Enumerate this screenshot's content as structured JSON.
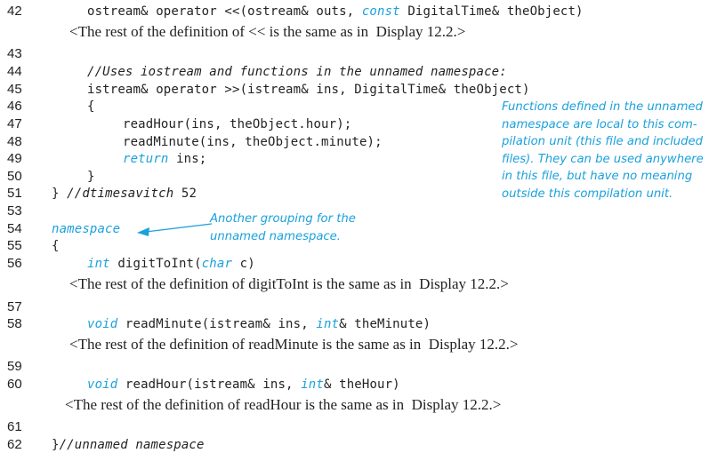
{
  "listing": {
    "lines": [
      {
        "num": "42",
        "parts": [
          {
            "t": "ostream& operator <<(ostream& outs, "
          },
          {
            "t": "const",
            "kw": true
          },
          {
            "t": " DigitalTime& theObject)"
          }
        ]
      },
      {
        "prose": "<The rest of the definition of << is the same as in  Display 12.2.>"
      },
      {
        "num": "43",
        "parts": []
      },
      {
        "num": "44",
        "parts": [
          {
            "t": "//Uses iostream and functions in the unnamed namespace:",
            "cm": true
          }
        ]
      },
      {
        "num": "45",
        "parts": [
          {
            "t": "istream& operator >>(istream& ins, DigitalTime& theObject)"
          }
        ]
      },
      {
        "num": "46",
        "parts": [
          {
            "t": "{"
          }
        ]
      },
      {
        "num": "47",
        "parts": [
          {
            "t": "readHour(ins, theObject.hour);"
          }
        ]
      },
      {
        "num": "48",
        "parts": [
          {
            "t": "readMinute(ins, theObject.minute);"
          }
        ]
      },
      {
        "num": "49",
        "parts": [
          {
            "t": "return",
            "kw": true
          },
          {
            "t": " ins;"
          }
        ]
      },
      {
        "num": "50",
        "parts": [
          {
            "t": "}"
          }
        ]
      },
      {
        "num": "51",
        "parts": [
          {
            "t": "} "
          },
          {
            "t": "//dtimesavitch",
            "cm": true
          },
          {
            "t": " 52"
          }
        ]
      },
      {
        "num": "53",
        "parts": []
      },
      {
        "num": "54",
        "parts": [
          {
            "t": "namespace",
            "kw": true
          }
        ]
      },
      {
        "num": "55",
        "parts": [
          {
            "t": "{"
          }
        ]
      },
      {
        "num": "56",
        "parts": [
          {
            "t": "int",
            "kw": true
          },
          {
            "t": " digitToInt("
          },
          {
            "t": "char",
            "kw": true
          },
          {
            "t": " c)"
          }
        ]
      },
      {
        "prose": "<The rest of the definition of digitToInt is the same as in  Display 12.2.>"
      },
      {
        "num": "57",
        "parts": []
      },
      {
        "num": "58",
        "parts": [
          {
            "t": "void",
            "kw": true
          },
          {
            "t": " readMinute(istream& ins, "
          },
          {
            "t": "int",
            "kw": true
          },
          {
            "t": "& theMinute)"
          }
        ]
      },
      {
        "prose": "<The rest of the definition of readMinute is the same as in  Display 12.2.>"
      },
      {
        "num": "59",
        "parts": []
      },
      {
        "num": "60",
        "parts": [
          {
            "t": "void",
            "kw": true
          },
          {
            "t": " readHour(istream& ins, "
          },
          {
            "t": "int",
            "kw": true
          },
          {
            "t": "& theHour)"
          }
        ]
      },
      {
        "prose": "<The rest of the definition of readHour is the same as in  Display 12.2.>"
      },
      {
        "num": "61",
        "parts": []
      },
      {
        "num": "62",
        "parts": [
          {
            "t": "}"
          },
          {
            "t": "//unnamed namespace",
            "cm": true
          }
        ]
      }
    ]
  },
  "annotations": {
    "unnamed_namespace_scope": [
      "Functions defined in the unnamed",
      "namespace are local to this com-",
      "pilation unit (this file and included",
      "files). They can be used anywhere",
      "in this file, but have no meaning",
      "outside this compilation unit."
    ],
    "another_grouping": [
      "Another grouping for the",
      "unnamed namespace."
    ]
  },
  "colors": {
    "keyword": "#1ba1dc",
    "annotation": "#1ba1dc",
    "text": "#222222"
  }
}
